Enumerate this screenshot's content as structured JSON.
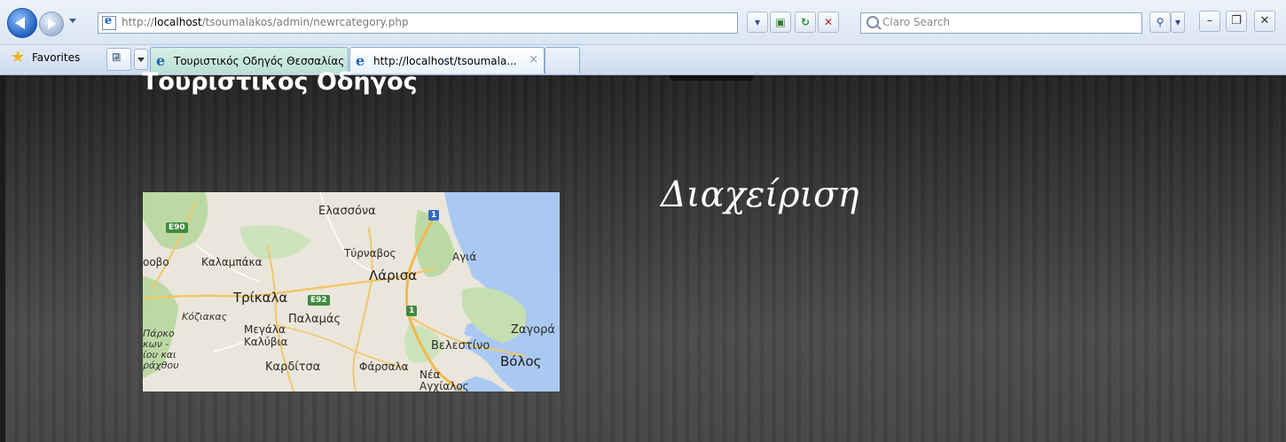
{
  "browser": {
    "address": {
      "url_prefix": "http://",
      "url_host": "localhost",
      "url_path": "/tsoumalakos/admin/newrcategory.php"
    },
    "search": {
      "placeholder": "Claro Search"
    },
    "favorites_label": "Favorites",
    "tabs": [
      {
        "label": "Τουριστικός Οδηγός Θεσσαλίας",
        "active": false
      },
      {
        "label": "http://localhost/tsoumala...",
        "active": true
      }
    ],
    "tab_close_glyph": "×",
    "window_buttons": {
      "minimize": "–",
      "restore": "❐",
      "close": "✕"
    },
    "icons": {
      "back": "back-arrow-icon",
      "forward": "forward-arrow-icon",
      "refresh": "refresh-icon",
      "stop": "stop-icon",
      "search": "search-icon",
      "favorites": "star-icon"
    }
  },
  "page": {
    "site_title": "Τουριστικος Οδηγος",
    "admin_heading": "Διαχείριση",
    "map": {
      "labels": {
        "elassona": "Ελασσόνα",
        "tyrnavos": "Τύρναβος",
        "agia": "Αγιά",
        "kalampaka": "Καλαμπάκα",
        "larisa": "Λάρισα",
        "trikala": "Τρίκαλα",
        "koziakas": "Κόζιακας",
        "palamas": "Παλαμάς",
        "megala_kalyvia": "Μεγάλα Καλύβια",
        "zagora": "Ζαγορά",
        "velestino": "Βελεστίνο",
        "volos": "Βόλος",
        "karditsa": "Καρδίτσα",
        "farsala": "Φάρσαλα",
        "nea_anchialos": "Νέα Αγχίαλος",
        "edge_oovo": "οοβο",
        "edge_park": "Πάρκο κων - ίου και ράχθου"
      },
      "shields": {
        "e90": "E90",
        "e92": "E92",
        "one_a": "1",
        "one_b": "1"
      }
    },
    "colors": {
      "background": "#2b2b2b",
      "text": "#ffffff"
    }
  }
}
